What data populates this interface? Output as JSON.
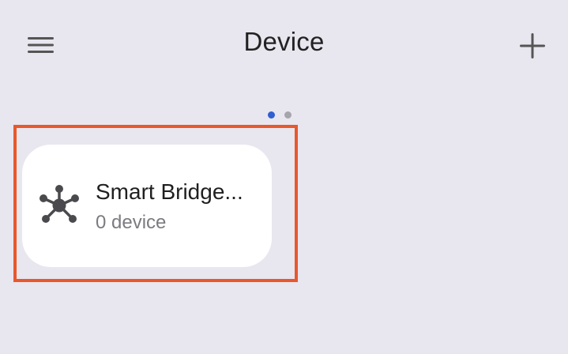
{
  "header": {
    "title": "Device",
    "menu_icon": "hamburger-menu-icon",
    "add_icon": "plus-icon"
  },
  "pager": {
    "total_pages": 2,
    "current_page": 1,
    "active_color": "#2f5fd0",
    "inactive_color": "#a5a5ab"
  },
  "devices": [
    {
      "name": "Smart Bridge...",
      "subtitle": "0 device",
      "icon": "network-hub-icon"
    }
  ],
  "colors": {
    "background": "#e8e6ef",
    "card": "#ffffff",
    "highlight": "#e8582c"
  }
}
